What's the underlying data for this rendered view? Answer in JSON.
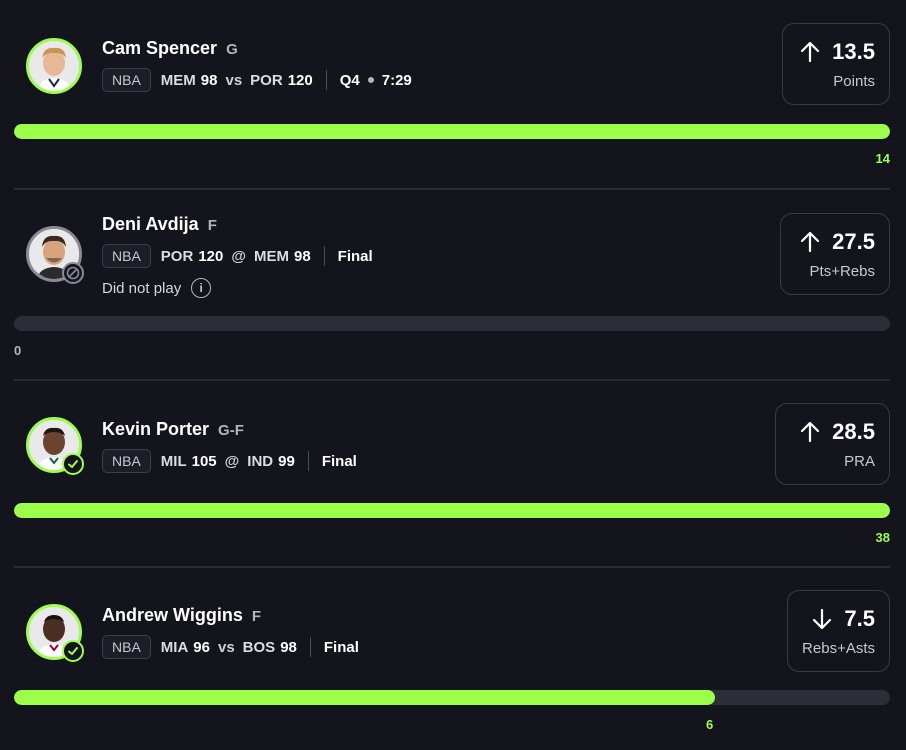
{
  "colors": {
    "background": "#14141d",
    "accent_green": "#9cff4a",
    "track_gray": "#2d2d38",
    "muted_text": "#b4b4be"
  },
  "picks": [
    {
      "player": "Cam Spencer",
      "position": "G",
      "league": "NBA",
      "team1": "MEM",
      "score1": "98",
      "connector": "vs",
      "team2": "POR",
      "score2": "120",
      "status": "Q4",
      "clock": "7:29",
      "direction_icon": "arrow-up-icon",
      "line": "13.5",
      "stat": "Points",
      "actual": "14",
      "progress": 1.0,
      "badge": "none"
    },
    {
      "player": "Deni Avdija",
      "position": "F",
      "league": "NBA",
      "team1": "POR",
      "score1": "120",
      "connector": "@",
      "team2": "MEM",
      "score2": "98",
      "status": "Final",
      "note": "Did not play",
      "direction_icon": "arrow-up-icon",
      "line": "27.5",
      "stat": "Pts+Rebs",
      "actual": "0",
      "progress": 0.0,
      "badge": "ban-icon"
    },
    {
      "player": "Kevin Porter",
      "position": "G-F",
      "league": "NBA",
      "team1": "MIL",
      "score1": "105",
      "connector": "@",
      "team2": "IND",
      "score2": "99",
      "status": "Final",
      "direction_icon": "arrow-up-icon",
      "line": "28.5",
      "stat": "PRA",
      "actual": "38",
      "progress": 1.0,
      "badge": "check-icon"
    },
    {
      "player": "Andrew Wiggins",
      "position": "F",
      "league": "NBA",
      "team1": "MIA",
      "score1": "96",
      "connector": "vs",
      "team2": "BOS",
      "score2": "98",
      "status": "Final",
      "direction_icon": "arrow-down-icon",
      "line": "7.5",
      "stat": "Rebs+Asts",
      "actual": "6",
      "progress": 0.8,
      "badge": "check-icon"
    }
  ]
}
